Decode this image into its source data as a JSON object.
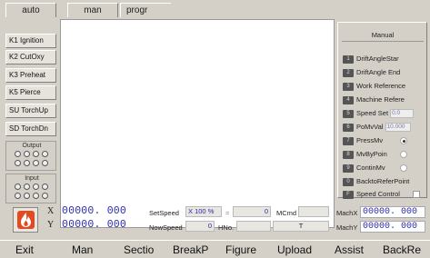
{
  "tabs": [
    "auto",
    "man",
    "progr"
  ],
  "left_buttons": [
    "K1 Ignition",
    "K2 CutOxy",
    "K3 Preheat",
    "K5 Pierce",
    "SU TorchUp",
    "SD TorchDn"
  ],
  "output_label": "Output",
  "input_label": "Input",
  "right_panel": {
    "title": "Manual",
    "items": [
      {
        "num": "1",
        "label": "DriftAngleStar"
      },
      {
        "num": "2",
        "label": "DriftAngle End"
      },
      {
        "num": "3",
        "label": "Work Reference"
      },
      {
        "num": "4",
        "label": "Machine Refere"
      },
      {
        "num": "5",
        "label": "Speed Set",
        "value": "0.0"
      },
      {
        "num": "6",
        "label": "PoMvVal",
        "value": "10.000"
      },
      {
        "num": "7",
        "label": "PressMv"
      },
      {
        "num": "8",
        "label": "MvByPoin"
      },
      {
        "num": "9",
        "label": "ContinMv"
      },
      {
        "num": "0",
        "label": "BacktoReferPoint"
      },
      {
        "num": "F",
        "label": "Speed Control"
      }
    ],
    "press_mv_selected": true
  },
  "coords": {
    "x_axis": "X",
    "y_axis": "Y",
    "x_value": "00000. 000",
    "y_value": "00000. 000",
    "set_speed_label": "SetSpeed",
    "set_speed_x": "X 100",
    "set_speed_unit": "%",
    "set_speed_eq": "=",
    "set_speed_val": "0",
    "now_speed_label": "NowSpeed",
    "now_speed_val": "0",
    "hno_label": "HNo.",
    "mcmd_label": "MCmd",
    "t_label": "T",
    "machx_label": "MachX",
    "machy_label": "MachY",
    "machx_value": "00000. 000",
    "machy_value": "00000. 000"
  },
  "menu": [
    "Exit",
    "Man",
    "Sectio",
    "BreakP",
    "Figure",
    "Upload",
    "Assist",
    "BackRe"
  ],
  "colors": {
    "value_blue": "#2a2aaa",
    "flame_red": "#e24a21",
    "panel_gray": "#d4d0c8"
  }
}
